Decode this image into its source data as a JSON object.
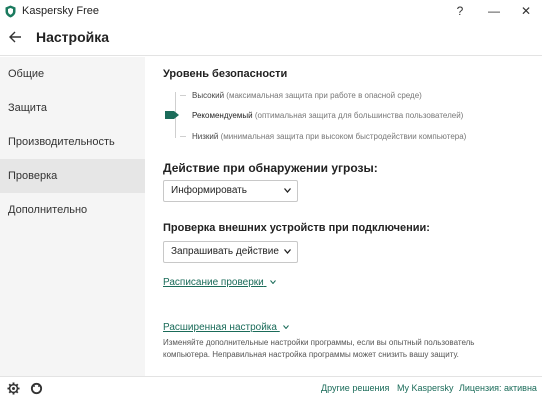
{
  "window": {
    "title": "Kaspersky Free",
    "help_label": "?",
    "minimize_label": "—",
    "close_label": "✕"
  },
  "header": {
    "title": "Настройка"
  },
  "sidebar": {
    "items": [
      {
        "label": "Общие"
      },
      {
        "label": "Защита"
      },
      {
        "label": "Производительность"
      },
      {
        "label": "Проверка"
      },
      {
        "label": "Дополнительно"
      }
    ],
    "active_index": 3
  },
  "security_level": {
    "title": "Уровень безопасности",
    "levels": [
      {
        "name": "Высокий",
        "description": "(максимальная защита при работе в опасной среде)"
      },
      {
        "name": "Рекомендуемый",
        "description": "(оптимальная защита для большинства пользователей)"
      },
      {
        "name": "Низкий",
        "description": "(минимальная защита при высоком быстродействии компьютера)"
      }
    ],
    "selected_index": 1
  },
  "threat_action": {
    "title": "Действие при обнаружении угрозы:",
    "selected": "Информировать"
  },
  "external_devices": {
    "title": "Проверка внешних устройств при подключении:",
    "selected": "Запрашивать действие"
  },
  "scan_schedule": {
    "label": "Расписание проверки"
  },
  "advanced": {
    "label": "Расширенная настройка",
    "description": "Изменяйте дополнительные настройки программы, если вы опытный пользователь компьютера. Неправильная настройка программы может снизить вашу защиту."
  },
  "footer": {
    "other_solutions": "Другие решения",
    "my_kaspersky": "My Kaspersky",
    "license": "Лицензия: активна"
  },
  "colors": {
    "accent": "#1a6b59",
    "sidebar_bg": "#f5f5f5",
    "sidebar_active": "#e6e6e6"
  },
  "icons": {
    "app": "kaspersky-shield-icon",
    "back": "back-arrow-icon",
    "settings": "gear-icon",
    "support": "support-icon"
  }
}
